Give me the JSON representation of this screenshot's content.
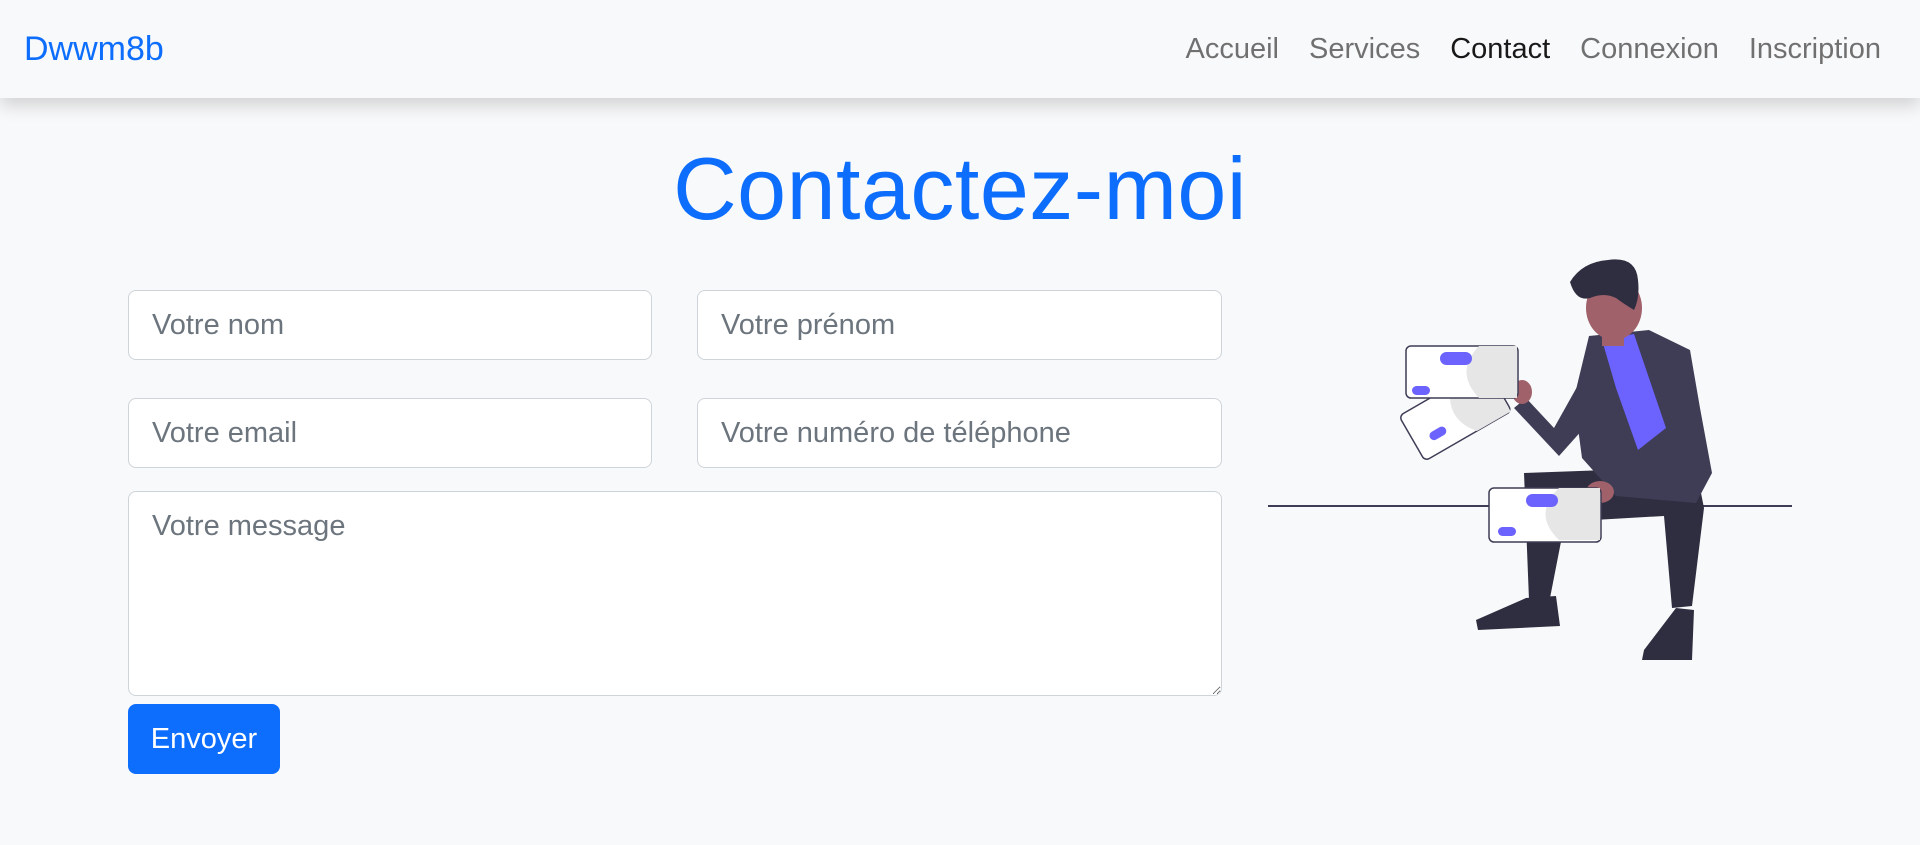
{
  "navbar": {
    "brand": "Dwwm8b",
    "links": [
      {
        "label": "Accueil",
        "active": false
      },
      {
        "label": "Services",
        "active": false
      },
      {
        "label": "Contact",
        "active": true
      },
      {
        "label": "Connexion",
        "active": false
      },
      {
        "label": "Inscription",
        "active": false
      }
    ]
  },
  "page": {
    "title": "Contactez-moi"
  },
  "form": {
    "nom_placeholder": "Votre nom",
    "prenom_placeholder": "Votre prénom",
    "email_placeholder": "Votre email",
    "telephone_placeholder": "Votre numéro de téléphone",
    "message_placeholder": "Votre message",
    "submit_label": "Envoyer"
  },
  "colors": {
    "primary": "#0d6efd",
    "background": "#f8f9fa",
    "illustration_accent": "#6c63ff",
    "illustration_dark": "#3f3d56"
  },
  "illustration": {
    "icon": "person-with-cards-illustration"
  }
}
